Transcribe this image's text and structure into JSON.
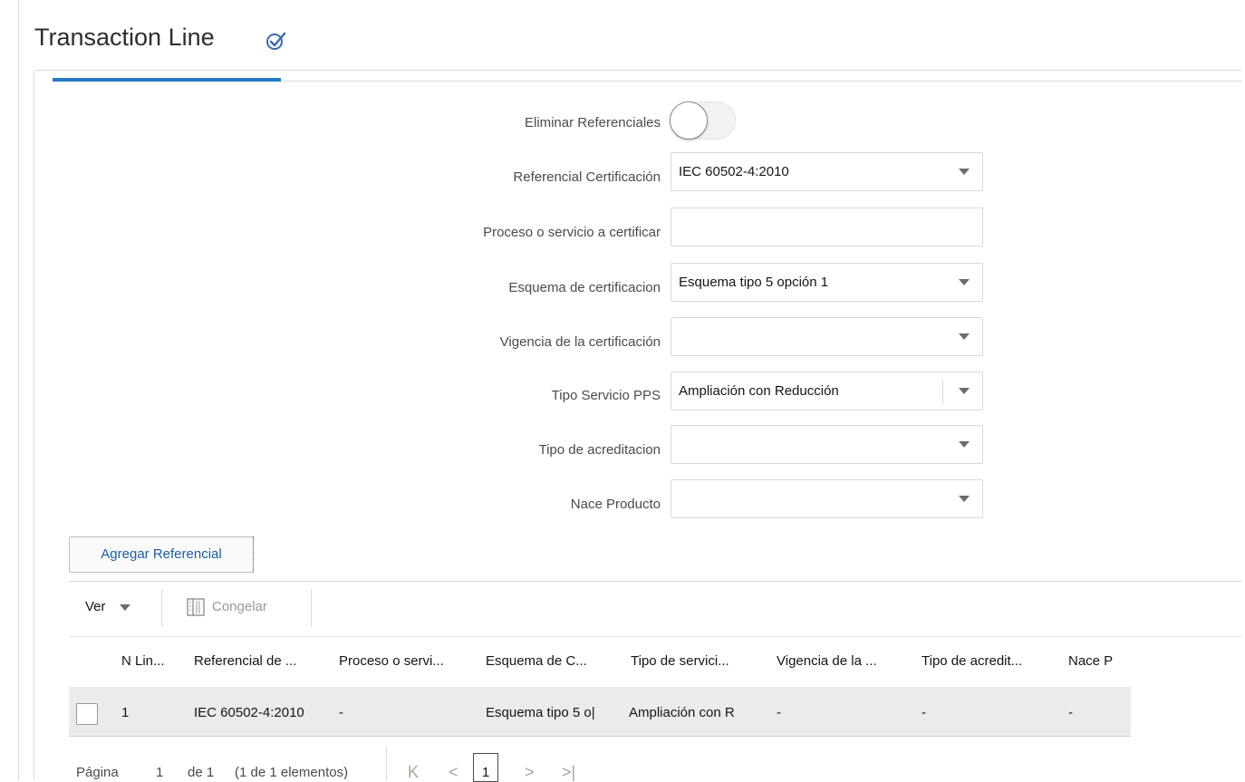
{
  "page": {
    "title": "Transaction Line"
  },
  "form": {
    "eliminar_label": "Eliminar Referenciales",
    "eliminar_toggle": false,
    "referencial_label": "Referencial Certificación",
    "referencial_value": "IEC 60502-4:2010",
    "proceso_label": "Proceso o servicio a certificar",
    "proceso_value": "",
    "esquema_label": "Esquema de certificacion",
    "esquema_value": "Esquema tipo 5 opción 1",
    "vigencia_label": "Vigencia de la certificación",
    "vigencia_value": "",
    "tipo_servicio_label": "Tipo Servicio PPS",
    "tipo_servicio_value": "Ampliación con Reducción",
    "tipo_acreditacion_label": "Tipo de acreditacion",
    "tipo_acreditacion_value": "",
    "nace_label": "Nace Producto",
    "nace_value": ""
  },
  "actions": {
    "add_label": "Agregar Referencial"
  },
  "toolbar": {
    "view_label": "Ver",
    "freeze_label": "Congelar"
  },
  "table": {
    "columns": [
      "N Lin...",
      "Referencial de ...",
      "Proceso o servi...",
      "Esquema de C...",
      "Tipo de servici...",
      "Vigencia de la ...",
      "Tipo de acredit...",
      "Nace P"
    ],
    "rows": [
      [
        "1",
        "IEC 60502-4:2010",
        "-",
        "Esquema tipo 5 o|",
        "Ampliación con R",
        "-",
        "-",
        "-"
      ]
    ]
  },
  "pagination": {
    "page_label": "Página",
    "page_number": "1",
    "of_label": "de 1",
    "summary": "(1 de 1 elementos)",
    "current_page": "1"
  },
  "colors": {
    "accent": "#227ac2",
    "link": "#1b5ea5",
    "row_bg": "#ebebeb"
  },
  "icons": {
    "title": "check-badge-icon",
    "freeze": "freeze-columns-icon",
    "first": "first-page-icon",
    "prev": "prev-page-icon",
    "next": "next-page-icon",
    "last": "last-page-icon"
  }
}
